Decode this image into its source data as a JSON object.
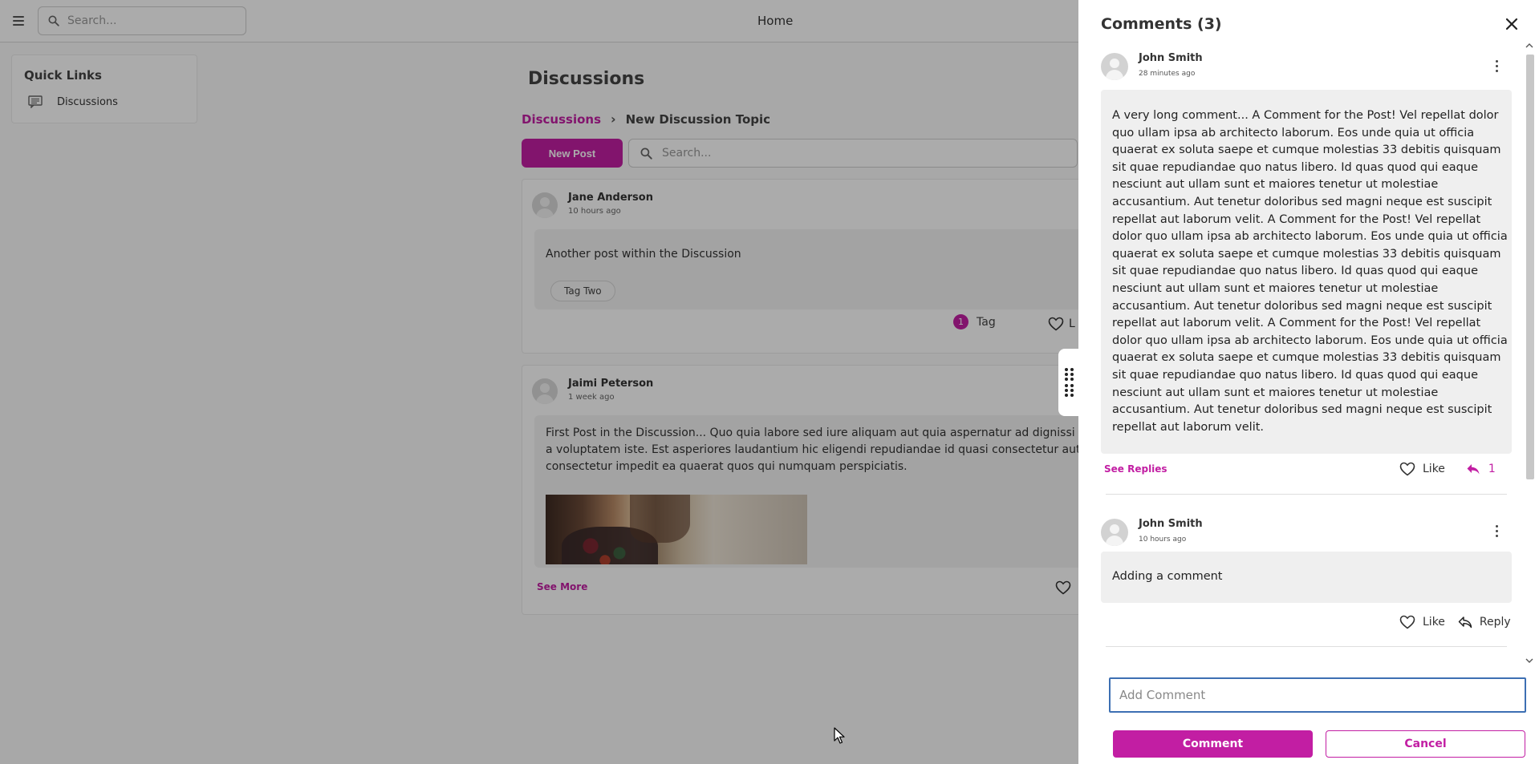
{
  "topbar": {
    "search_placeholder": "Search...",
    "title": "Home"
  },
  "quick_links": {
    "title": "Quick Links",
    "items": [
      {
        "label": "Discussions",
        "icon": "chat-icon"
      }
    ]
  },
  "discussions": {
    "title": "Discussions",
    "breadcrumb": {
      "parent": "Discussions",
      "current": "New Discussion Topic"
    },
    "new_post_label": "New Post",
    "search_placeholder": "Search..."
  },
  "posts": [
    {
      "author": "Jane Anderson",
      "time": "10 hours ago",
      "text": "Another post within the Discussion",
      "tag": "Tag Two",
      "tag_count": "1",
      "tag_label": "Tag",
      "like_partial": "L"
    },
    {
      "author": "Jaimi Peterson",
      "time": "1 week ago",
      "text_lines": [
        "First Post in the Discussion... Quo quia labore sed iure aliquam aut quia aspernatur ad dignissi",
        "a voluptatem iste. Est asperiores laudantium hic eligendi repudiandae id quasi consectetur aut",
        "consectetur impedit ea quaerat quos qui numquam perspiciatis."
      ],
      "see_more": "See More"
    }
  ],
  "comments_panel": {
    "title": "Comments (3)",
    "comments": [
      {
        "author": "John Smith",
        "time": "28 minutes ago",
        "text_lines": [
          "A very long comment... A Comment for the Post! Vel repellat dolor",
          "quo ullam ipsa ab architecto laborum. Eos unde quia ut officia",
          "quaerat ex soluta saepe et cumque molestias 33 debitis quisquam",
          "sit quae repudiandae quo natus libero. Id quas quod qui eaque",
          "nesciunt aut ullam sunt et maiores tenetur ut molestiae",
          "accusantium. Aut tenetur doloribus sed magni neque est suscipit",
          "repellat aut laborum velit. A Comment for the Post! Vel repellat",
          "dolor quo ullam ipsa ab architecto laborum. Eos unde quia ut officia",
          "quaerat ex soluta saepe et cumque molestias 33 debitis quisquam",
          "sit quae repudiandae quo natus libero. Id quas quod qui eaque",
          "nesciunt aut ullam sunt et maiores tenetur ut molestiae",
          "accusantium. Aut tenetur doloribus sed magni neque est suscipit",
          "repellat aut laborum velit. A Comment for the Post! Vel repellat",
          "dolor quo ullam ipsa ab architecto laborum. Eos unde quia ut officia",
          "quaerat ex soluta saepe et cumque molestias 33 debitis quisquam",
          "sit quae repudiandae quo natus libero. Id quas quod qui eaque",
          "nesciunt aut ullam sunt et maiores tenetur ut molestiae",
          "accusantium. Aut tenetur doloribus sed magni neque est suscipit",
          "repellat aut laborum velit."
        ],
        "see_replies": "See Replies",
        "like_label": "Like",
        "reply_count": "1"
      },
      {
        "author": "John Smith",
        "time": "10 hours ago",
        "text": "Adding a comment",
        "like_label": "Like",
        "reply_label": "Reply"
      }
    ],
    "add_comment_placeholder": "Add Comment",
    "comment_button": "Comment",
    "cancel_button": "Cancel"
  },
  "colors": {
    "accent": "#c21ea3",
    "input_focus": "#3d6fb3",
    "overlay": "rgba(0,0,0,0.33)"
  }
}
